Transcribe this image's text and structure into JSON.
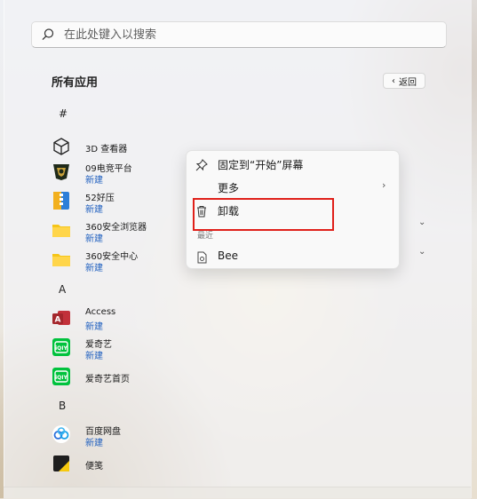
{
  "search": {
    "placeholder": "在此处键入以搜索"
  },
  "header": {
    "title": "所有应用",
    "back_label": "返回"
  },
  "sections": [
    {
      "letter": "#"
    },
    {
      "letter": "A"
    },
    {
      "letter": "B"
    }
  ],
  "apps": [
    {
      "name": "3D 查看器",
      "badge": ""
    },
    {
      "name": "09电竞平台",
      "badge": "新建"
    },
    {
      "name": "52好压",
      "badge": "新建"
    },
    {
      "name": "360安全浏览器",
      "badge": "新建"
    },
    {
      "name": "360安全中心",
      "badge": "新建"
    },
    {
      "name": "Access",
      "badge": "新建"
    },
    {
      "name": "爱奇艺",
      "badge": "新建"
    },
    {
      "name": "爱奇艺首页",
      "badge": ""
    },
    {
      "name": "百度网盘",
      "badge": "新建"
    },
    {
      "name": "便笺",
      "badge": ""
    }
  ],
  "context_menu": {
    "pin_label": "固定到“开始”屏幕",
    "more_label": "更多",
    "uninstall_label": "卸载",
    "recent_section": "最近",
    "recent_item": "Bee"
  },
  "colors": {
    "highlight": "#e0201a",
    "badge": "#1f5fbf"
  }
}
